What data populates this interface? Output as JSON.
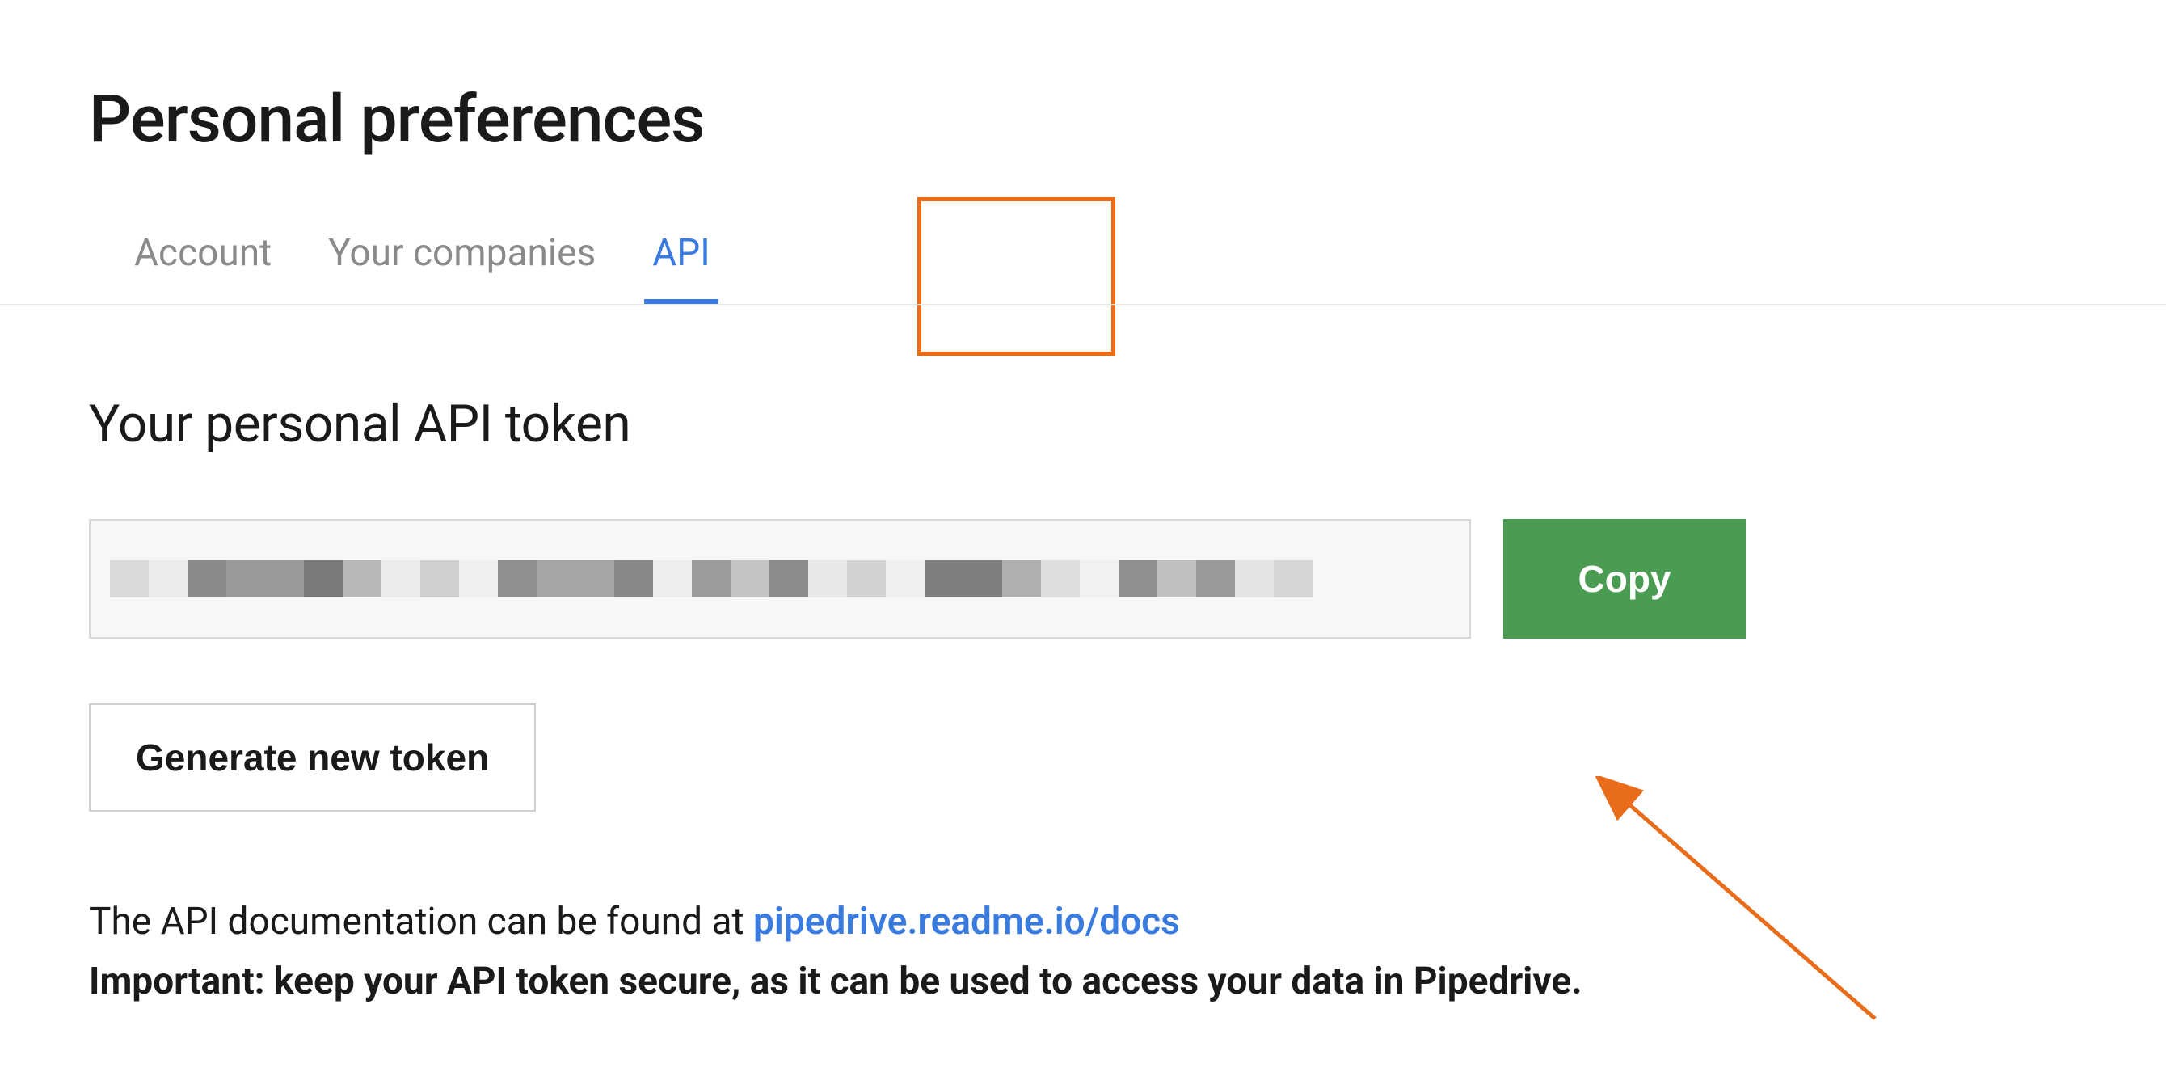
{
  "page": {
    "title": "Personal preferences"
  },
  "tabs": {
    "items": [
      {
        "label": "Account",
        "active": false
      },
      {
        "label": "Your companies",
        "active": false
      },
      {
        "label": "API",
        "active": true
      }
    ]
  },
  "section": {
    "heading": "Your personal API token"
  },
  "token": {
    "value_redacted": true,
    "copy_label": "Copy",
    "generate_label": "Generate new token"
  },
  "info": {
    "doc_prefix": "The API documentation can be found at ",
    "doc_link_text": "pipedrive.readme.io/docs",
    "important_text": "Important: keep your API token secure, as it can be used to access your data in Pipedrive."
  },
  "colors": {
    "accent_blue": "#3a7be0",
    "button_green": "#4a9c52",
    "highlight_orange": "#e86c1a"
  }
}
